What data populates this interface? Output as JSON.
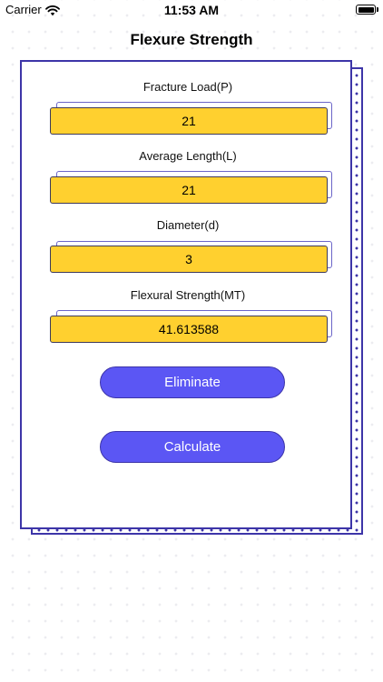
{
  "status_bar": {
    "carrier": "Carrier",
    "time": "11:53 AM",
    "wifi_icon": "wifi-icon",
    "battery_icon": "battery-icon"
  },
  "title": "Flexure Strength",
  "fields": [
    {
      "label": "Fracture Load(P)",
      "value": "21"
    },
    {
      "label": "Average Length(L)",
      "value": "21"
    },
    {
      "label": "Diameter(d)",
      "value": "3"
    },
    {
      "label": "Flexural Strength(MT)",
      "value": "41.613588"
    }
  ],
  "buttons": {
    "eliminate": "Eliminate",
    "calculate": "Calculate"
  },
  "colors": {
    "accent": "#5b56f4",
    "border": "#3d35a8",
    "field_fill": "#ffd02f"
  }
}
